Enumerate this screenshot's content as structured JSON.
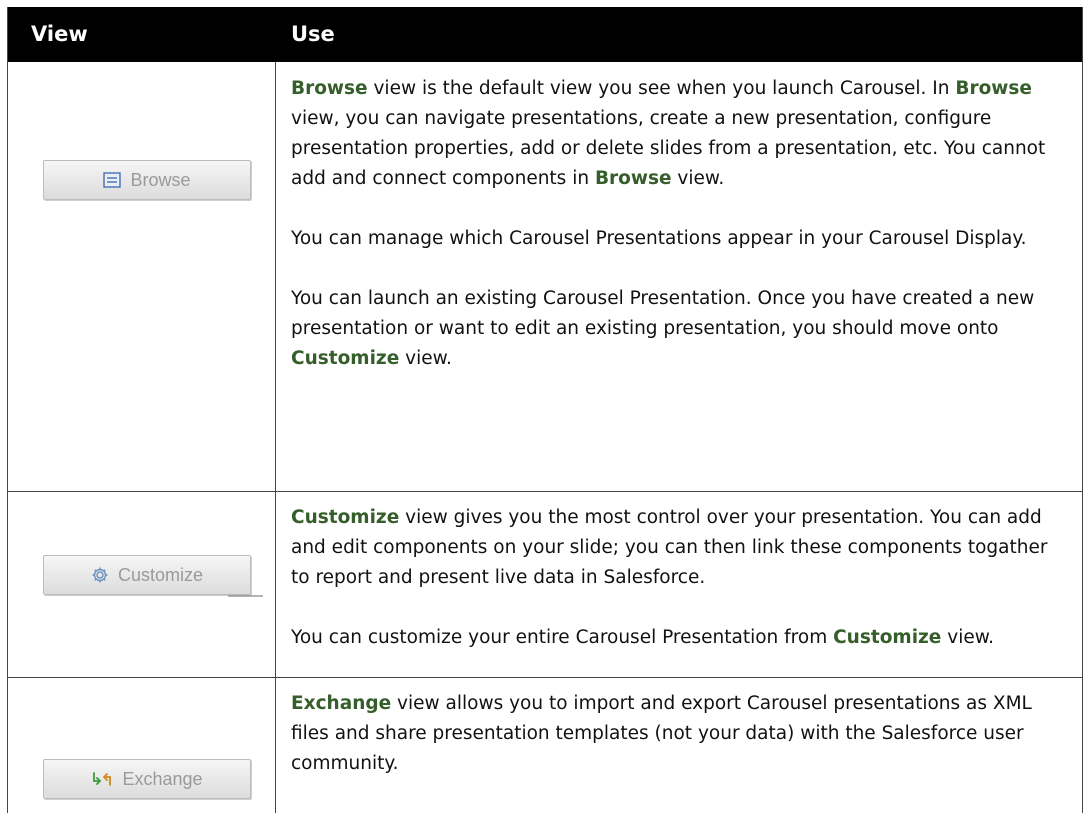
{
  "header": {
    "view": "View",
    "use": "Use"
  },
  "rows": [
    {
      "button": {
        "label": "Browse",
        "icon": "monitor-icon"
      },
      "paragraphs": [
        [
          {
            "b": "Browse"
          },
          {
            "t": " view is the default view you see when you launch Carousel. In "
          },
          {
            "b": "Browse"
          },
          {
            "t": " view, you can navigate presentations, create a new presentation, configure presentation properties, add or delete slides from a presentation, etc. You cannot add and connect components in "
          },
          {
            "b": "Browse"
          },
          {
            "t": " view."
          }
        ],
        [
          {
            "t": "You can manage which Carousel Presentations appear in your Carousel Display."
          }
        ],
        [
          {
            "t": "You can launch an existing Carousel Presentation. Once you have created a new presentation or want to edit an existing presentation, you should move onto "
          },
          {
            "b": "Customize"
          },
          {
            "t": " view."
          }
        ]
      ]
    },
    {
      "button": {
        "label": "Customize",
        "icon": "gear-icon"
      },
      "paragraphs": [
        [
          {
            "b": "Customize"
          },
          {
            "t": " view gives you the most control over your presentation. You can add and edit components on your slide; you can then link these components togather to report and present live data in Salesforce."
          }
        ],
        [
          {
            "t": "You can customize your entire Carousel Presentation from "
          },
          {
            "b": "Customize"
          },
          {
            "t": " view."
          }
        ]
      ]
    },
    {
      "button": {
        "label": "Exchange",
        "icon": "exchange-arrows-icon"
      },
      "paragraphs": [
        [
          {
            "b": "Exchange"
          },
          {
            "t": " view allows you to import and export Carousel presentations as XML files and share presentation templates (not your data) with the Salesforce user community."
          }
        ]
      ]
    }
  ],
  "colors": {
    "keyword": "#355e2a",
    "header_bg": "#000000",
    "header_text": "#ffffff"
  }
}
